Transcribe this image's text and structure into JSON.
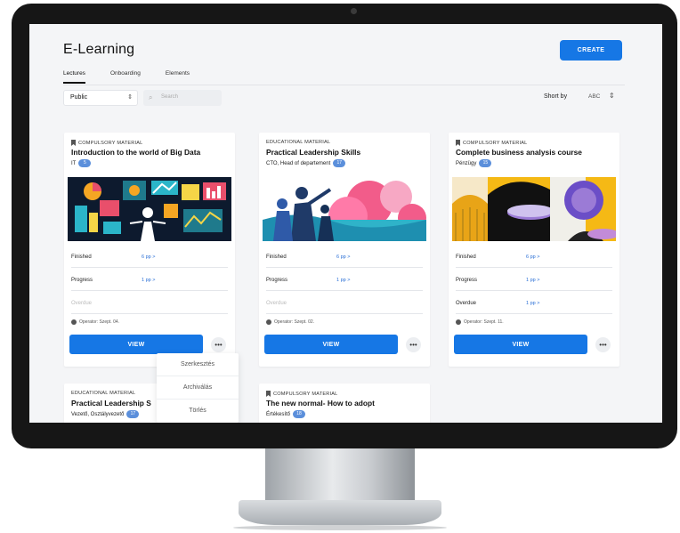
{
  "header": {
    "title": "E-Learning",
    "create_label": "CREATE"
  },
  "tabs": [
    {
      "label": "Lectures",
      "active": true
    },
    {
      "label": "Onboarding",
      "active": false
    },
    {
      "label": "Elements",
      "active": false
    }
  ],
  "filters": {
    "visibility_value": "Public",
    "search_placeholder": "Search",
    "sort_label": "Short by",
    "sort_value": "ABC"
  },
  "cards": [
    {
      "type": "COMPULSORY MATERIAL",
      "title": "Introduction to the world of Big Data",
      "subtitle": "IT",
      "badge": "5",
      "rows": [
        {
          "label": "Finished",
          "value": "6 pp >"
        },
        {
          "label": "Progress",
          "value": "1 pp >"
        },
        {
          "label": "Overdue",
          "value": ""
        }
      ],
      "operator": "Operator: Szept. 04.",
      "view_label": "VIEW",
      "more_label": "•••"
    },
    {
      "type": "EDUCATIONAL MATERIAL",
      "title": "Practical Leadership Skills",
      "subtitle": "CTO, Head of departement",
      "badge": "17",
      "rows": [
        {
          "label": "Finished",
          "value": "6 pp >"
        },
        {
          "label": "Progress",
          "value": "1 pp >"
        },
        {
          "label": "Overdue",
          "value": ""
        }
      ],
      "operator": "Operator: Szept. 02.",
      "view_label": "VIEW",
      "more_label": "•••"
    },
    {
      "type": "COMPULSORY MATERIAL",
      "title": "Complete business analysis course",
      "subtitle": "Pénzügy",
      "badge": "15",
      "rows": [
        {
          "label": "Finished",
          "value": "6 pp >"
        },
        {
          "label": "Progress",
          "value": "1 pp >"
        },
        {
          "label": "Overdue",
          "value": "1 pp >"
        }
      ],
      "operator": "Operator: Szept. 11.",
      "view_label": "VIEW",
      "more_label": "•••"
    },
    {
      "type": "EDUCATIONAL MATERIAL",
      "title": "Practical Leadership S",
      "subtitle": "Vezető, Osztályvezető",
      "badge": "17"
    },
    {
      "type": "COMPULSORY MATERIAL",
      "title": "The new normal- How to adopt",
      "subtitle": "Értékesítő",
      "badge": "18"
    }
  ],
  "dropdown": [
    "Szerkesztés",
    "Archiválás",
    "Törlés"
  ],
  "colors": {
    "accent": "#1677e5",
    "badge": "#5b8fdb",
    "screen_bg": "#f4f5f7"
  }
}
